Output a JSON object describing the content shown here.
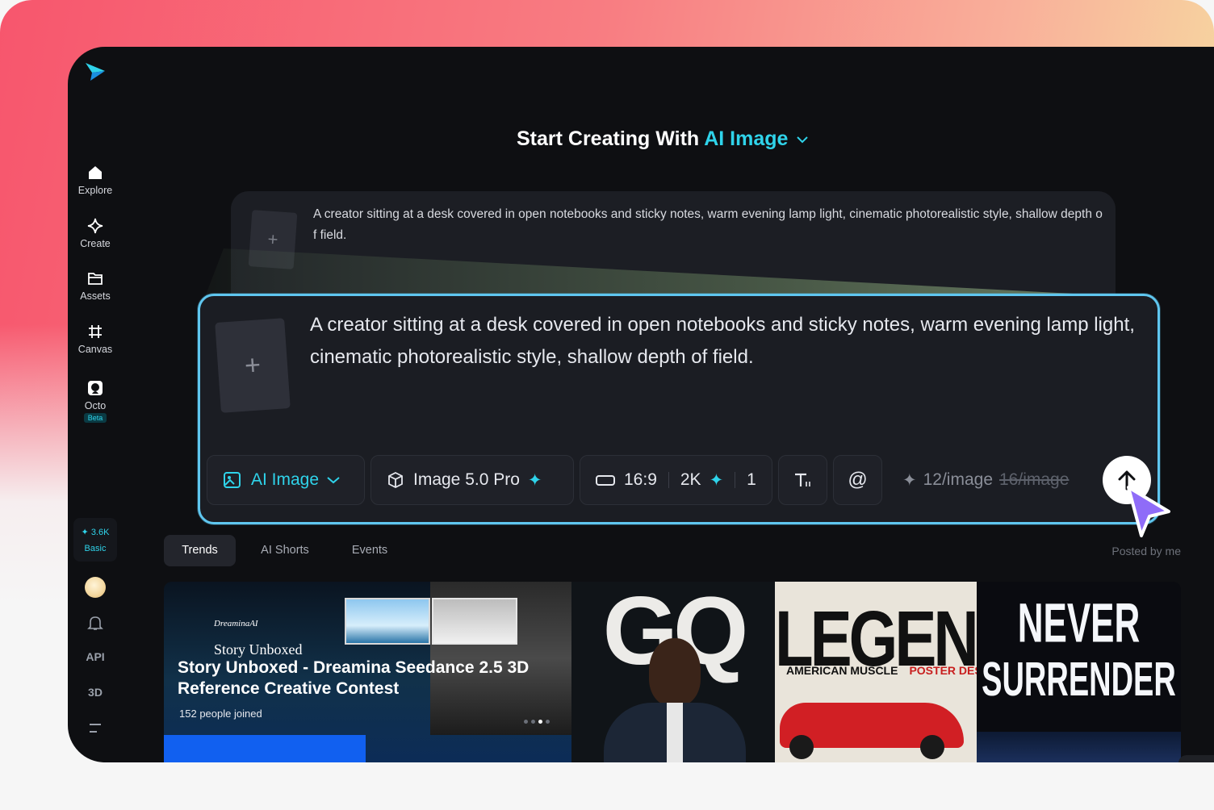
{
  "sidebar": {
    "items": [
      {
        "label": "Explore",
        "icon": "home-icon"
      },
      {
        "label": "Create",
        "icon": "diamond-icon"
      },
      {
        "label": "Assets",
        "icon": "folder-icon"
      },
      {
        "label": "Canvas",
        "icon": "crop-icon"
      },
      {
        "label": "Octo",
        "icon": "octo-icon",
        "badge": "Beta"
      }
    ],
    "credits": {
      "amount": "3.6K",
      "plan": "Basic"
    },
    "extra": {
      "api": "API",
      "three_d": "3D"
    }
  },
  "header": {
    "prefix": "Start Creating With",
    "mode": "AI Image"
  },
  "back_prompt": {
    "text": "A creator sitting at a desk covered in open notebooks and sticky notes, warm evening lamp light, cinematic photorealistic style, shallow depth of field."
  },
  "prompt": {
    "text": "A creator sitting at a desk covered in open notebooks and sticky notes, warm evening lamp light, cinematic photorealistic style, shallow depth of field.",
    "add_symbol": "+"
  },
  "toolbar": {
    "mode_label": "AI Image",
    "model_label": "Image 5.0 Pro",
    "ratio": "16:9",
    "resolution": "2K",
    "count": "1",
    "mention_symbol": "@",
    "cost": "12/image",
    "original_cost": "16/image"
  },
  "tabs": [
    {
      "label": "Trends",
      "active": true
    },
    {
      "label": "AI Shorts",
      "active": false
    },
    {
      "label": "Events",
      "active": false
    }
  ],
  "posted_by_me": "Posted by me",
  "gallery": {
    "promo": {
      "brand": "DreaminaAI",
      "story": "Story Unboxed",
      "title": "Story Unboxed - Dreamina Seedance 2.5 3D Reference Creative Contest",
      "joined": "152",
      "joined_suffix": "people joined"
    },
    "gq": {
      "letters": "GQ"
    },
    "legend": {
      "word": "LEGEND",
      "sub_left": "AMERICAN MUSCLE",
      "sub_right": "POSTER DESIGN"
    },
    "never": {
      "line1": "NEVER",
      "line2": "SURRENDER"
    }
  },
  "colors": {
    "accent": "#2fd3ea",
    "card_border": "#5fc6ef",
    "background": "#0e0f12"
  }
}
